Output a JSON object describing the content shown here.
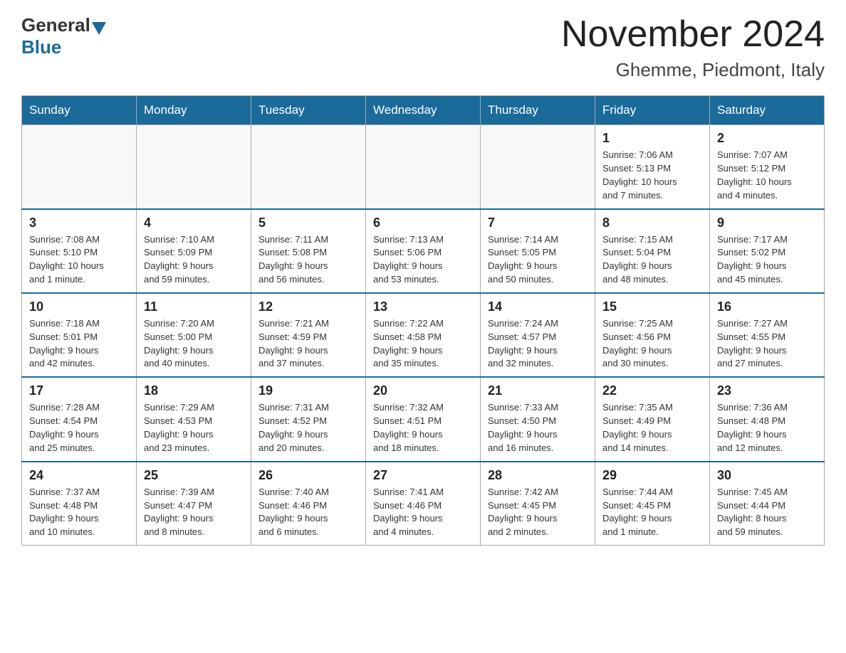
{
  "header": {
    "logo_general": "General",
    "logo_blue": "Blue",
    "title": "November 2024",
    "subtitle": "Ghemme, Piedmont, Italy"
  },
  "weekdays": [
    "Sunday",
    "Monday",
    "Tuesday",
    "Wednesday",
    "Thursday",
    "Friday",
    "Saturday"
  ],
  "weeks": [
    [
      {
        "day": "",
        "info": ""
      },
      {
        "day": "",
        "info": ""
      },
      {
        "day": "",
        "info": ""
      },
      {
        "day": "",
        "info": ""
      },
      {
        "day": "",
        "info": ""
      },
      {
        "day": "1",
        "info": "Sunrise: 7:06 AM\nSunset: 5:13 PM\nDaylight: 10 hours\nand 7 minutes."
      },
      {
        "day": "2",
        "info": "Sunrise: 7:07 AM\nSunset: 5:12 PM\nDaylight: 10 hours\nand 4 minutes."
      }
    ],
    [
      {
        "day": "3",
        "info": "Sunrise: 7:08 AM\nSunset: 5:10 PM\nDaylight: 10 hours\nand 1 minute."
      },
      {
        "day": "4",
        "info": "Sunrise: 7:10 AM\nSunset: 5:09 PM\nDaylight: 9 hours\nand 59 minutes."
      },
      {
        "day": "5",
        "info": "Sunrise: 7:11 AM\nSunset: 5:08 PM\nDaylight: 9 hours\nand 56 minutes."
      },
      {
        "day": "6",
        "info": "Sunrise: 7:13 AM\nSunset: 5:06 PM\nDaylight: 9 hours\nand 53 minutes."
      },
      {
        "day": "7",
        "info": "Sunrise: 7:14 AM\nSunset: 5:05 PM\nDaylight: 9 hours\nand 50 minutes."
      },
      {
        "day": "8",
        "info": "Sunrise: 7:15 AM\nSunset: 5:04 PM\nDaylight: 9 hours\nand 48 minutes."
      },
      {
        "day": "9",
        "info": "Sunrise: 7:17 AM\nSunset: 5:02 PM\nDaylight: 9 hours\nand 45 minutes."
      }
    ],
    [
      {
        "day": "10",
        "info": "Sunrise: 7:18 AM\nSunset: 5:01 PM\nDaylight: 9 hours\nand 42 minutes."
      },
      {
        "day": "11",
        "info": "Sunrise: 7:20 AM\nSunset: 5:00 PM\nDaylight: 9 hours\nand 40 minutes."
      },
      {
        "day": "12",
        "info": "Sunrise: 7:21 AM\nSunset: 4:59 PM\nDaylight: 9 hours\nand 37 minutes."
      },
      {
        "day": "13",
        "info": "Sunrise: 7:22 AM\nSunset: 4:58 PM\nDaylight: 9 hours\nand 35 minutes."
      },
      {
        "day": "14",
        "info": "Sunrise: 7:24 AM\nSunset: 4:57 PM\nDaylight: 9 hours\nand 32 minutes."
      },
      {
        "day": "15",
        "info": "Sunrise: 7:25 AM\nSunset: 4:56 PM\nDaylight: 9 hours\nand 30 minutes."
      },
      {
        "day": "16",
        "info": "Sunrise: 7:27 AM\nSunset: 4:55 PM\nDaylight: 9 hours\nand 27 minutes."
      }
    ],
    [
      {
        "day": "17",
        "info": "Sunrise: 7:28 AM\nSunset: 4:54 PM\nDaylight: 9 hours\nand 25 minutes."
      },
      {
        "day": "18",
        "info": "Sunrise: 7:29 AM\nSunset: 4:53 PM\nDaylight: 9 hours\nand 23 minutes."
      },
      {
        "day": "19",
        "info": "Sunrise: 7:31 AM\nSunset: 4:52 PM\nDaylight: 9 hours\nand 20 minutes."
      },
      {
        "day": "20",
        "info": "Sunrise: 7:32 AM\nSunset: 4:51 PM\nDaylight: 9 hours\nand 18 minutes."
      },
      {
        "day": "21",
        "info": "Sunrise: 7:33 AM\nSunset: 4:50 PM\nDaylight: 9 hours\nand 16 minutes."
      },
      {
        "day": "22",
        "info": "Sunrise: 7:35 AM\nSunset: 4:49 PM\nDaylight: 9 hours\nand 14 minutes."
      },
      {
        "day": "23",
        "info": "Sunrise: 7:36 AM\nSunset: 4:48 PM\nDaylight: 9 hours\nand 12 minutes."
      }
    ],
    [
      {
        "day": "24",
        "info": "Sunrise: 7:37 AM\nSunset: 4:48 PM\nDaylight: 9 hours\nand 10 minutes."
      },
      {
        "day": "25",
        "info": "Sunrise: 7:39 AM\nSunset: 4:47 PM\nDaylight: 9 hours\nand 8 minutes."
      },
      {
        "day": "26",
        "info": "Sunrise: 7:40 AM\nSunset: 4:46 PM\nDaylight: 9 hours\nand 6 minutes."
      },
      {
        "day": "27",
        "info": "Sunrise: 7:41 AM\nSunset: 4:46 PM\nDaylight: 9 hours\nand 4 minutes."
      },
      {
        "day": "28",
        "info": "Sunrise: 7:42 AM\nSunset: 4:45 PM\nDaylight: 9 hours\nand 2 minutes."
      },
      {
        "day": "29",
        "info": "Sunrise: 7:44 AM\nSunset: 4:45 PM\nDaylight: 9 hours\nand 1 minute."
      },
      {
        "day": "30",
        "info": "Sunrise: 7:45 AM\nSunset: 4:44 PM\nDaylight: 8 hours\nand 59 minutes."
      }
    ]
  ]
}
